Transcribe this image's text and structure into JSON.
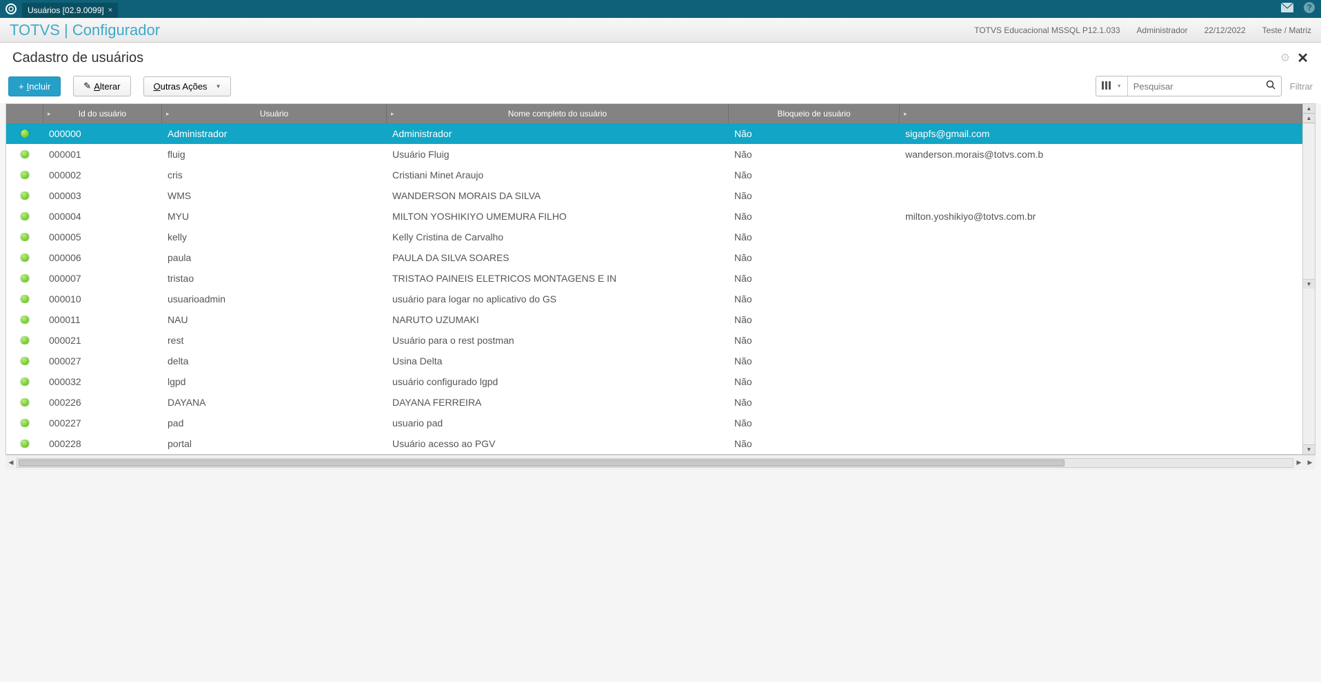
{
  "titlebar": {
    "tab_label": "Usuários [02.9.0099]"
  },
  "header": {
    "app_title": "TOTVS | Configurador",
    "env": "TOTVS Educacional MSSQL P12.1.033",
    "user": "Administrador",
    "date": "22/12/2022",
    "context": "Teste / Matriz"
  },
  "page": {
    "title": "Cadastro de usuários"
  },
  "toolbar": {
    "include_label": "Incluir",
    "alter_label": "Alterar",
    "other_label": "Outras Ações",
    "search_placeholder": "Pesquisar",
    "filter_label": "Filtrar"
  },
  "columns": {
    "id": "Id do usuário",
    "user": "Usuário",
    "fullname": "Nome completo do usuário",
    "blocked": "Bloqueio de usuário"
  },
  "rows": [
    {
      "id": "000000",
      "user": "Administrador",
      "fullname": "Administrador",
      "blocked": "Não",
      "email": "sigapfs@gmail.com",
      "selected": true
    },
    {
      "id": "000001",
      "user": "fluig",
      "fullname": "Usuário Fluig",
      "blocked": "Não",
      "email": "wanderson.morais@totvs.com.b"
    },
    {
      "id": "000002",
      "user": "cris",
      "fullname": "Cristiani Minet Araujo",
      "blocked": "Não",
      "email": ""
    },
    {
      "id": "000003",
      "user": "WMS",
      "fullname": "WANDERSON MORAIS DA SILVA",
      "blocked": "Não",
      "email": ""
    },
    {
      "id": "000004",
      "user": "MYU",
      "fullname": "MILTON YOSHIKIYO UMEMURA FILHO",
      "blocked": "Não",
      "email": "milton.yoshikiyo@totvs.com.br"
    },
    {
      "id": "000005",
      "user": "kelly",
      "fullname": "Kelly Cristina de Carvalho",
      "blocked": "Não",
      "email": ""
    },
    {
      "id": "000006",
      "user": "paula",
      "fullname": "PAULA DA SILVA SOARES",
      "blocked": "Não",
      "email": ""
    },
    {
      "id": "000007",
      "user": "tristao",
      "fullname": "TRISTAO PAINEIS ELETRICOS MONTAGENS E IN",
      "blocked": "Não",
      "email": ""
    },
    {
      "id": "000010",
      "user": "usuarioadmin",
      "fullname": "usuário para logar no aplicativo do GS",
      "blocked": "Não",
      "email": ""
    },
    {
      "id": "000011",
      "user": "NAU",
      "fullname": "NARUTO UZUMAKI",
      "blocked": "Não",
      "email": ""
    },
    {
      "id": "000021",
      "user": "rest",
      "fullname": "Usuário para o rest postman",
      "blocked": "Não",
      "email": ""
    },
    {
      "id": "000027",
      "user": "delta",
      "fullname": "Usina Delta",
      "blocked": "Não",
      "email": ""
    },
    {
      "id": "000032",
      "user": "lgpd",
      "fullname": "usuário configurado lgpd",
      "blocked": "Não",
      "email": ""
    },
    {
      "id": "000226",
      "user": "DAYANA",
      "fullname": "DAYANA FERREIRA",
      "blocked": "Não",
      "email": ""
    },
    {
      "id": "000227",
      "user": "pad",
      "fullname": "usuario pad",
      "blocked": "Não",
      "email": ""
    },
    {
      "id": "000228",
      "user": "portal",
      "fullname": "Usuário acesso ao PGV",
      "blocked": "Não",
      "email": ""
    }
  ]
}
